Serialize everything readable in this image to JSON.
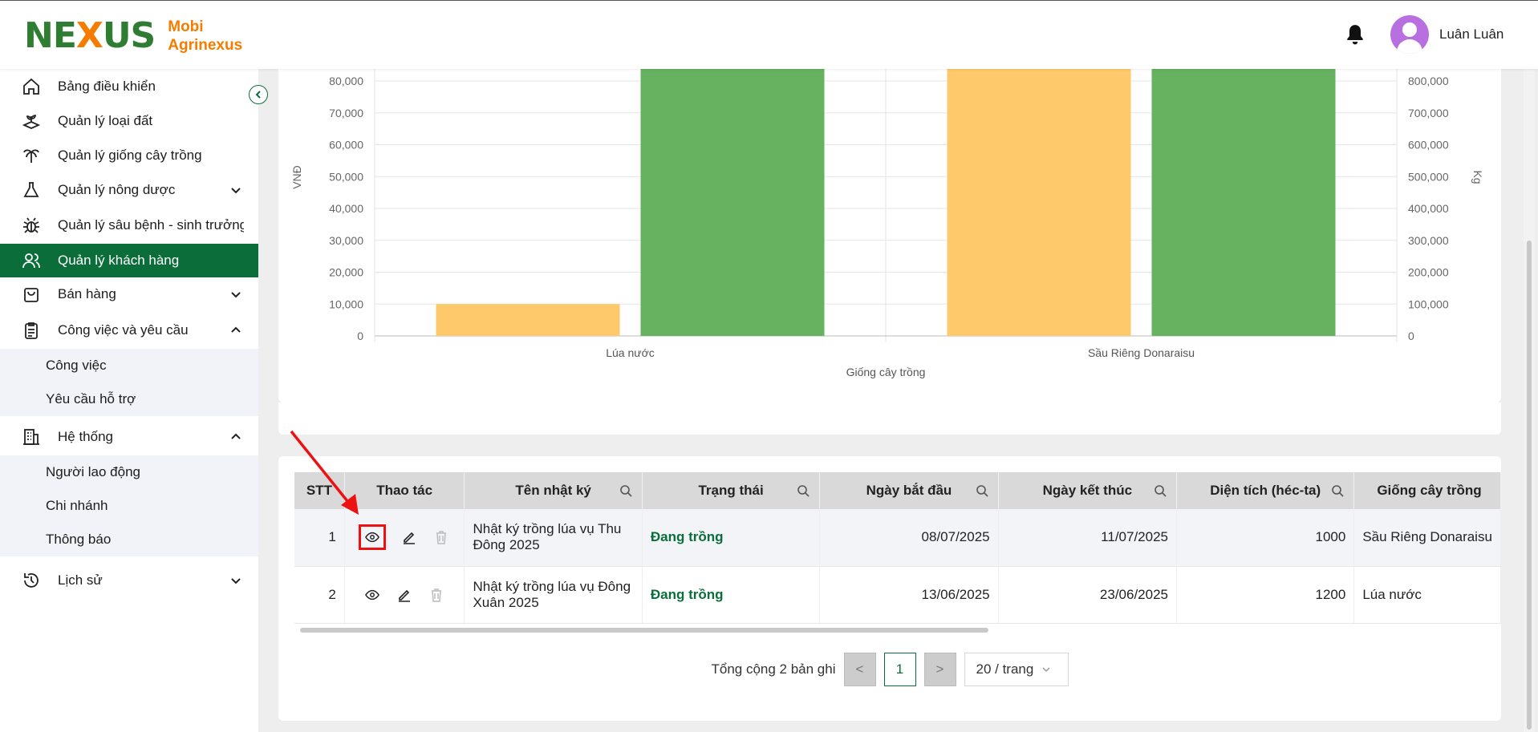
{
  "header": {
    "logo_mark": "NEXUS",
    "brand_line1": "Mobi",
    "brand_line2": "Agrinexus",
    "username": "Luân Luân"
  },
  "sidebar": {
    "items": [
      {
        "label": "Bảng điều khiển",
        "icon": "home-icon"
      },
      {
        "label": "Quản lý loại đất",
        "icon": "soil-icon"
      },
      {
        "label": "Quản lý giống cây trồng",
        "icon": "palm-tree-icon"
      },
      {
        "label": "Quản lý nông dược",
        "icon": "flask-icon"
      },
      {
        "label": "Quản lý sâu bệnh - sinh trưởng",
        "icon": "bug-icon"
      },
      {
        "label": "Quản lý khách hàng",
        "icon": "users-icon"
      },
      {
        "label": "Bán hàng",
        "icon": "shopping-bag-icon"
      },
      {
        "label": "Công việc và yêu cầu",
        "icon": "clipboard-icon"
      },
      {
        "label": "Hệ thống",
        "icon": "building-icon"
      },
      {
        "label": "Lịch sử",
        "icon": "history-icon"
      }
    ],
    "sub_work": [
      "Công việc",
      "Yêu cầu hỗ trợ"
    ],
    "sub_system": [
      "Người lao động",
      "Chi nhánh",
      "Thông báo"
    ]
  },
  "chart_data": {
    "type": "bar",
    "categories": [
      "Lúa nước",
      "Sầu Riêng Donaraisu"
    ],
    "series": [
      {
        "axis": "left",
        "color": "#fdc96b",
        "values": [
          10000,
          85000
        ]
      },
      {
        "axis": "right",
        "color": "#66b260",
        "values": [
          850000,
          850000
        ]
      }
    ],
    "xlabel": "Giống cây trồng",
    "ylabel": "VNĐ",
    "y2label": "Kg",
    "ylim": [
      0,
      80000
    ],
    "y2lim": [
      0,
      800000
    ],
    "yticks": [
      "0",
      "10,000",
      "20,000",
      "30,000",
      "40,000",
      "50,000",
      "60,000",
      "70,000",
      "80,000"
    ],
    "y2ticks": [
      "0",
      "100,000",
      "200,000",
      "300,000",
      "400,000",
      "500,000",
      "600,000",
      "700,000",
      "800,000"
    ],
    "grid": true
  },
  "table": {
    "columns": [
      "STT",
      "Thao tác",
      "Tên nhật ký",
      "Trạng thái",
      "Ngày bắt đầu",
      "Ngày kết thúc",
      "Diện tích (héc-ta)",
      "Giống cây trồng"
    ],
    "rows": [
      {
        "stt": "1",
        "name": "Nhật ký trồng lúa vụ Thu Đông 2025",
        "status": "Đang trồng",
        "start": "08/07/2025",
        "end": "11/07/2025",
        "area": "1000",
        "crop": "Sầu Riêng Donaraisu"
      },
      {
        "stt": "2",
        "name": "Nhật ký trồng lúa vụ Đông Xuân 2025",
        "status": "Đang trồng",
        "start": "13/06/2025",
        "end": "23/06/2025",
        "area": "1200",
        "crop": "Lúa nước"
      }
    ]
  },
  "pager": {
    "total": "Tổng cộng 2 bản ghi",
    "current": "1",
    "page_size": "20 / trang",
    "prev": "<",
    "next": ">"
  },
  "colors": {
    "brand_green": "#0b6e3a",
    "brand_orange": "#f57c00",
    "bar_orange": "#fdc96b",
    "bar_green": "#66b260",
    "annotation_red": "#ee1111"
  }
}
